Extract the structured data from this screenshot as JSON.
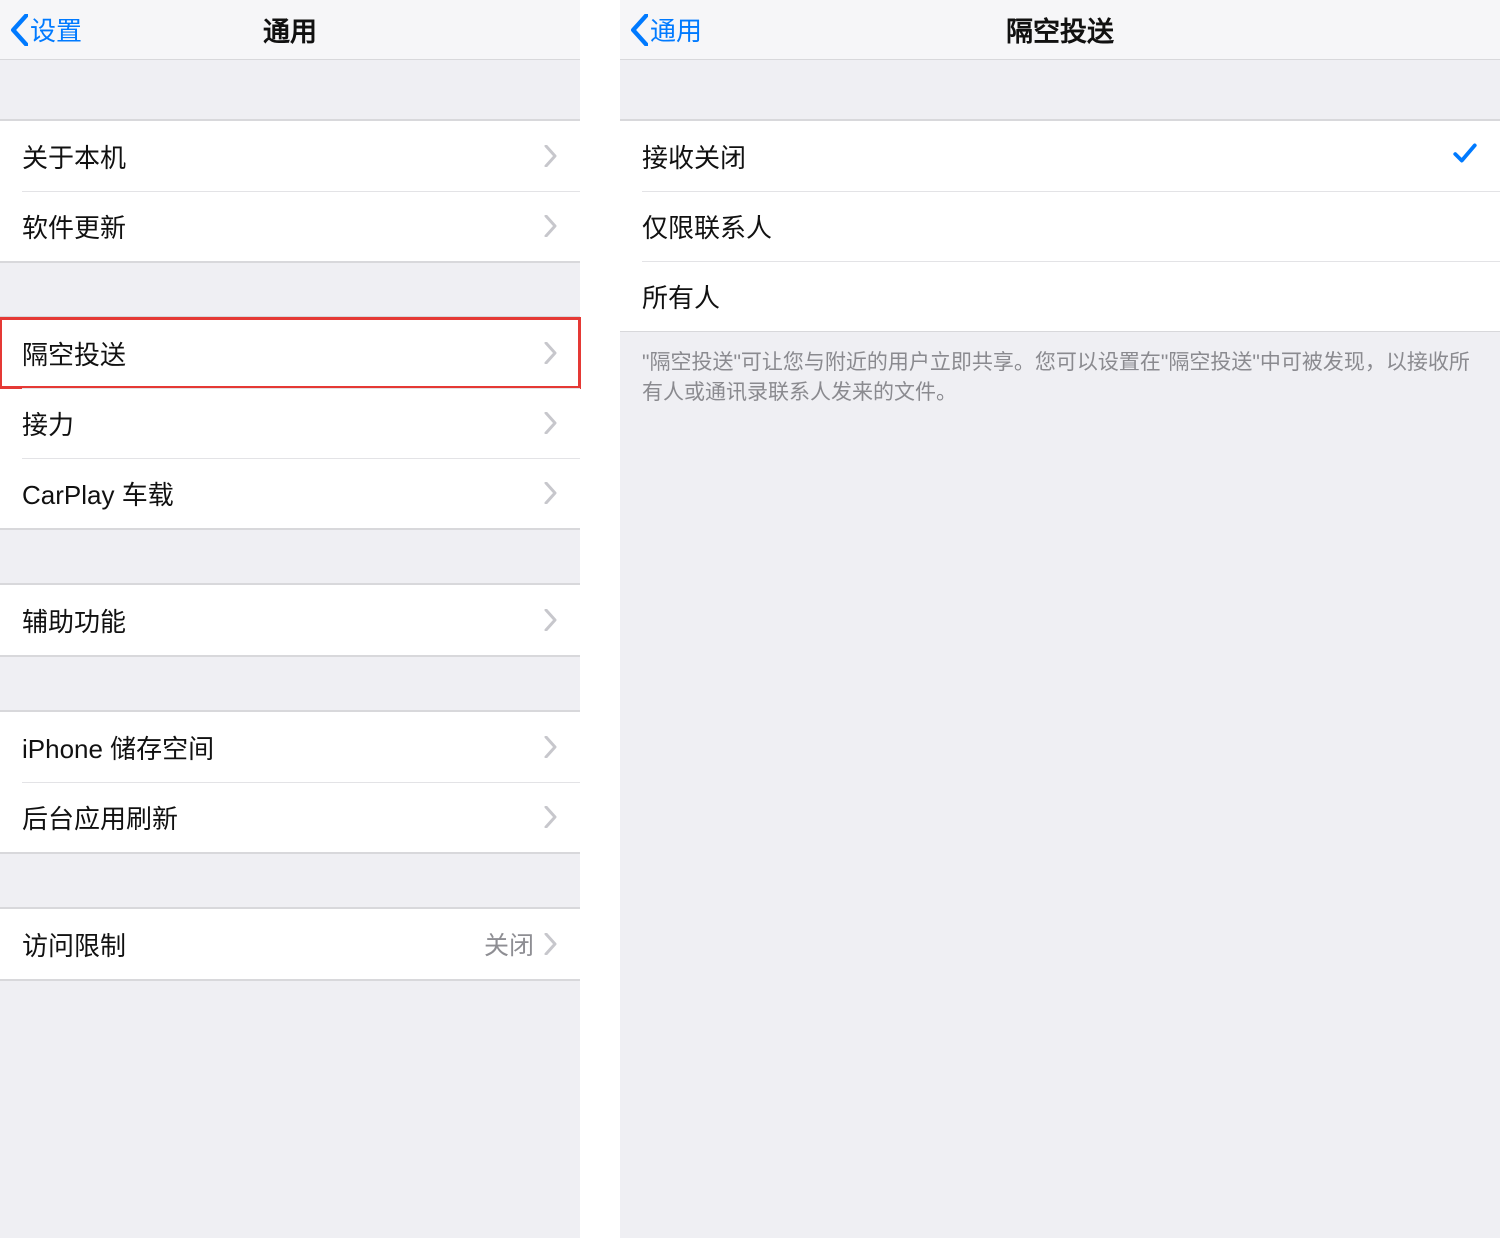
{
  "colors": {
    "accent": "#007aff",
    "highlight": "#e53935"
  },
  "left": {
    "back_label": "设置",
    "title": "通用",
    "groups": [
      {
        "rows": [
          {
            "label": "关于本机",
            "highlighted": false
          },
          {
            "label": "软件更新",
            "highlighted": false
          }
        ]
      },
      {
        "rows": [
          {
            "label": "隔空投送",
            "highlighted": true
          },
          {
            "label": "接力",
            "highlighted": false
          },
          {
            "label": "CarPlay 车载",
            "highlighted": false
          }
        ]
      },
      {
        "rows": [
          {
            "label": "辅助功能",
            "highlighted": false
          }
        ]
      },
      {
        "rows": [
          {
            "label": "iPhone 储存空间",
            "highlighted": false
          },
          {
            "label": "后台应用刷新",
            "highlighted": false
          }
        ]
      },
      {
        "rows": [
          {
            "label": "访问限制",
            "value": "关闭",
            "highlighted": false
          }
        ]
      }
    ]
  },
  "right": {
    "back_label": "通用",
    "title": "隔空投送",
    "options": [
      {
        "label": "接收关闭",
        "selected": true
      },
      {
        "label": "仅限联系人",
        "selected": false
      },
      {
        "label": "所有人",
        "selected": false
      }
    ],
    "footer": "\"隔空投送\"可让您与附近的用户立即共享。您可以设置在\"隔空投送\"中可被发现，以接收所有人或通讯录联系人发来的文件。"
  }
}
